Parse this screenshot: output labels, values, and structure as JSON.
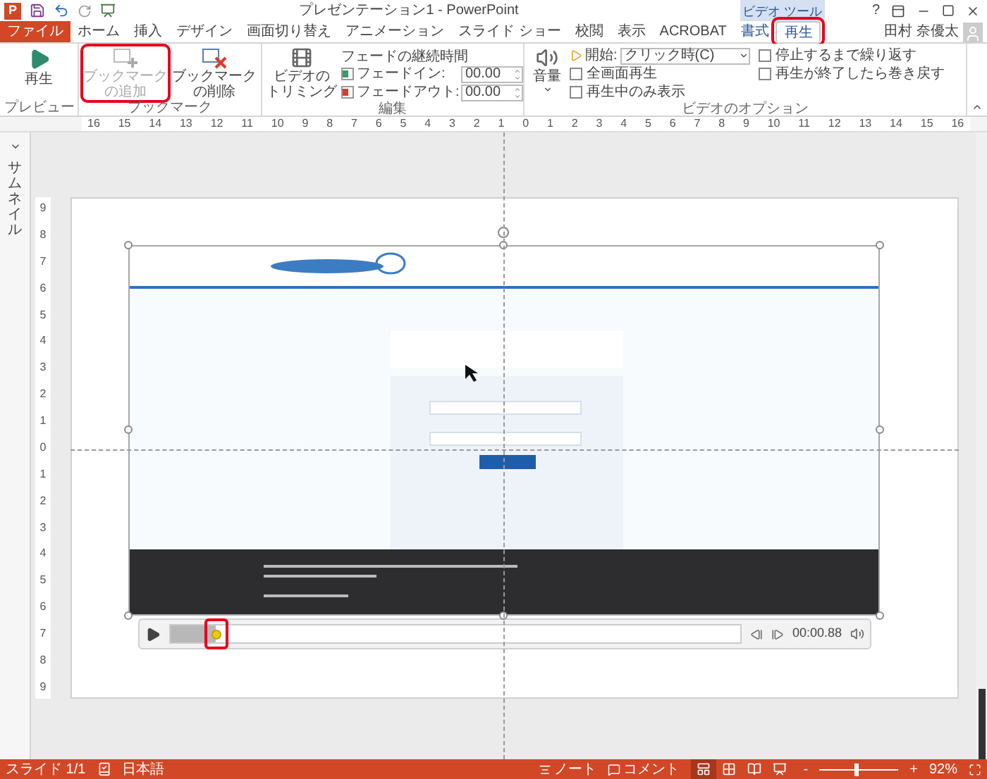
{
  "window": {
    "app_logo": "P",
    "title": "プレゼンテーション1 - PowerPoint",
    "context_label": "ビデオ ツール",
    "help": "?",
    "user": "田村 奈優太"
  },
  "tabs": [
    {
      "label": "ファイル",
      "kind": "file",
      "selected": false,
      "highlighted": false
    },
    {
      "label": "ホーム",
      "kind": "normal",
      "selected": false,
      "highlighted": false
    },
    {
      "label": "挿入",
      "kind": "normal",
      "selected": false,
      "highlighted": false
    },
    {
      "label": "デザイン",
      "kind": "normal",
      "selected": false,
      "highlighted": false
    },
    {
      "label": "画面切り替え",
      "kind": "normal",
      "selected": false,
      "highlighted": false
    },
    {
      "label": "アニメーション",
      "kind": "normal",
      "selected": false,
      "highlighted": false
    },
    {
      "label": "スライド ショー",
      "kind": "normal",
      "selected": false,
      "highlighted": false
    },
    {
      "label": "校閲",
      "kind": "normal",
      "selected": false,
      "highlighted": false
    },
    {
      "label": "表示",
      "kind": "normal",
      "selected": false,
      "highlighted": false
    },
    {
      "label": "ACROBAT",
      "kind": "normal",
      "selected": false,
      "highlighted": false
    },
    {
      "label": "書式",
      "kind": "context",
      "selected": false,
      "highlighted": false
    },
    {
      "label": "再生",
      "kind": "context",
      "selected": true,
      "highlighted": true
    }
  ],
  "ribbon": {
    "preview": {
      "label": "プレビュー",
      "play": "再生"
    },
    "bookmarks": {
      "label": "ブックマーク",
      "add": {
        "lines": [
          "ブックマーク",
          "の追加"
        ],
        "disabled": true,
        "highlighted": true
      },
      "remove": {
        "lines": [
          "ブックマーク",
          "の削除"
        ],
        "disabled": false,
        "highlighted": false
      }
    },
    "edit": {
      "label": "編集",
      "trim": [
        "ビデオの",
        "トリミング"
      ],
      "fade_title": "フェードの継続時間",
      "fade_in": {
        "label": "フェードイン:",
        "value": "00.00"
      },
      "fade_out": {
        "label": "フェードアウト:",
        "value": "00.00"
      }
    },
    "options": {
      "label": "ビデオのオプション",
      "volume": "音量",
      "start_label": "開始:",
      "start_value": "クリック時(C)",
      "checkboxes": [
        {
          "label": "全画面再生",
          "checked": false
        },
        {
          "label": "再生中のみ表示",
          "checked": false
        },
        {
          "label": "停止するまで繰り返す",
          "checked": false
        },
        {
          "label": "再生が終了したら巻き戻す",
          "checked": false
        }
      ]
    }
  },
  "ruler": [
    "16",
    "15",
    "14",
    "13",
    "12",
    "11",
    "10",
    "9",
    "8",
    "7",
    "6",
    "5",
    "4",
    "3",
    "2",
    "1",
    "0",
    "1",
    "2",
    "3",
    "4",
    "5",
    "6",
    "7",
    "8",
    "9",
    "10",
    "11",
    "12",
    "13",
    "14",
    "15",
    "16"
  ],
  "vertical_ruler": [
    "9",
    "8",
    "7",
    "6",
    "5",
    "4",
    "3",
    "2",
    "1",
    "0",
    "1",
    "2",
    "3",
    "4",
    "5",
    "6",
    "7",
    "8",
    "9"
  ],
  "thumbnail_pane": "サムネイル",
  "player": {
    "level": 0.08,
    "thumb_highlighted": true,
    "time": "00:00.88"
  },
  "status": {
    "slide": "スライド 1/1",
    "language": "日本語",
    "notes": "ノート",
    "comments": "コメント",
    "views": [
      {
        "kind": "normal",
        "selected": true
      },
      {
        "kind": "sorter",
        "selected": false
      },
      {
        "kind": "reading",
        "selected": false
      },
      {
        "kind": "slideshow",
        "selected": false
      }
    ],
    "zoom_minus": "-",
    "zoom_plus": "+",
    "zoom_slider": {
      "level": 0.47
    },
    "zoom": "92%"
  }
}
